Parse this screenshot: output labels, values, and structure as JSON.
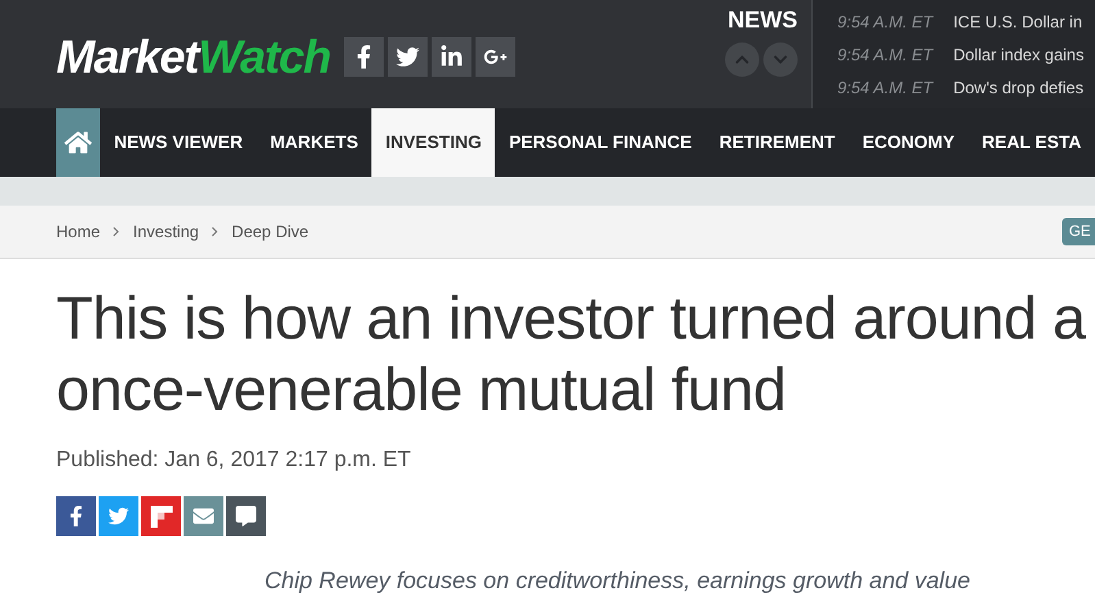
{
  "header": {
    "logo": {
      "part_1": "Market",
      "part_2": "Watch"
    },
    "social_icons": [
      {
        "kind": "facebook"
      },
      {
        "kind": "twitter"
      },
      {
        "kind": "linkedin"
      },
      {
        "kind": "googleplus"
      }
    ],
    "latest_news": {
      "label": "NEWS"
    },
    "ticker": [
      {
        "time": "9:54 A.M. ET",
        "headline": "ICE U.S. Dollar in"
      },
      {
        "time": "9:54 A.M. ET",
        "headline": "Dollar index gains"
      },
      {
        "time": "9:54 A.M. ET",
        "headline": "Dow's drop defies"
      }
    ]
  },
  "nav": {
    "items": [
      {
        "label": "NEWS VIEWER",
        "selected": false
      },
      {
        "label": "MARKETS",
        "selected": false
      },
      {
        "label": "INVESTING",
        "selected": true
      },
      {
        "label": "PERSONAL FINANCE",
        "selected": false
      },
      {
        "label": "RETIREMENT",
        "selected": false
      },
      {
        "label": "ECONOMY",
        "selected": false
      },
      {
        "label": "REAL ESTA",
        "selected": false
      }
    ]
  },
  "breadcrumbs": [
    "Home",
    "Investing",
    "Deep Dive"
  ],
  "breadcrumb_button": "GE",
  "article": {
    "title": "This is how an investor turned around a once-venerable mutual fund",
    "published": "Published: Jan 6, 2017 2:17 p.m. ET",
    "share_buttons": [
      {
        "kind": "facebook"
      },
      {
        "kind": "twitter"
      },
      {
        "kind": "flipboard"
      },
      {
        "kind": "email"
      },
      {
        "kind": "comment"
      }
    ],
    "subtitle": "Chip Rewey focuses on creditworthiness, earnings growth and value"
  }
}
